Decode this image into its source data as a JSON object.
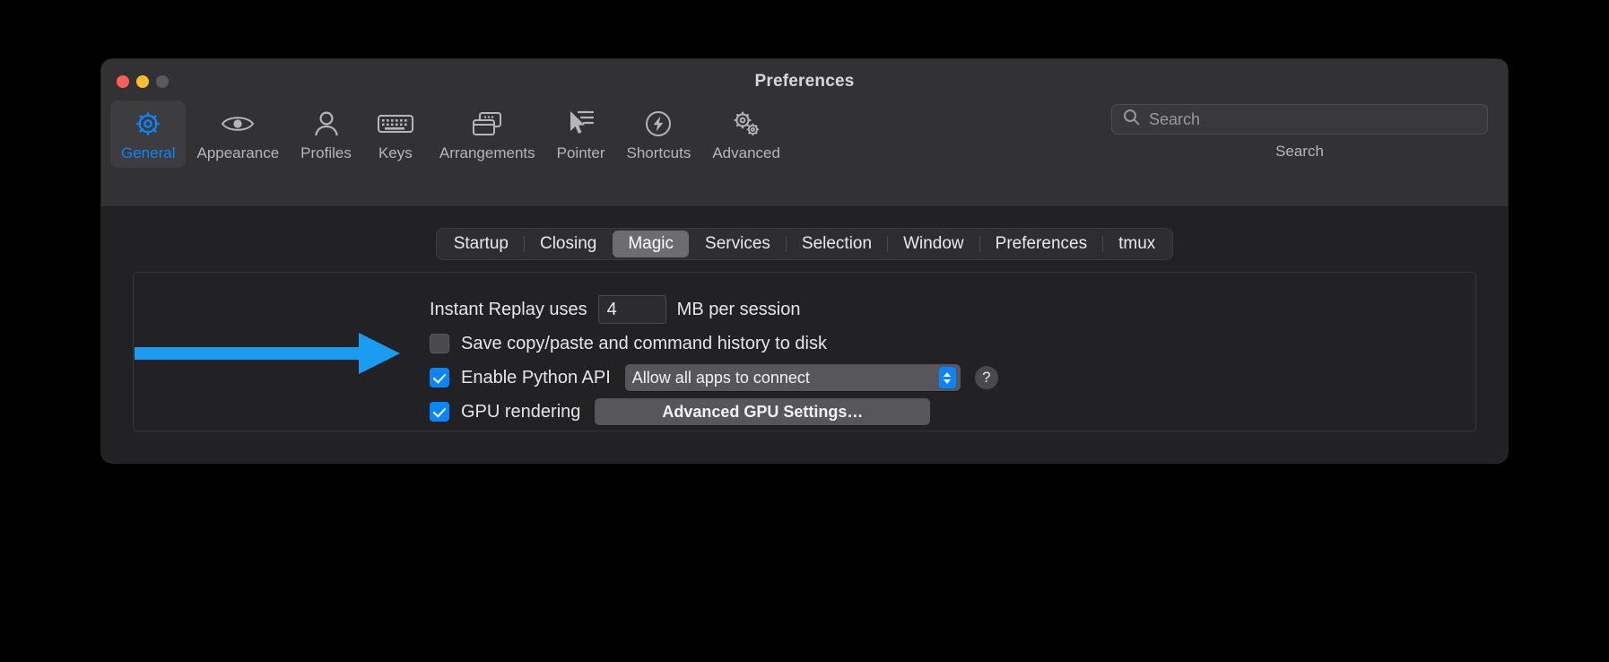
{
  "window": {
    "title": "Preferences",
    "traffic_lights": [
      "close-red",
      "minimize-yellow",
      "zoom-disabled"
    ]
  },
  "toolbar": {
    "items": [
      {
        "label": "General",
        "icon": "gear-icon",
        "selected": true
      },
      {
        "label": "Appearance",
        "icon": "eye-icon",
        "selected": false
      },
      {
        "label": "Profiles",
        "icon": "person-icon",
        "selected": false
      },
      {
        "label": "Keys",
        "icon": "keyboard-icon",
        "selected": false
      },
      {
        "label": "Arrangements",
        "icon": "windows-icon",
        "selected": false
      },
      {
        "label": "Pointer",
        "icon": "cursor-icon",
        "selected": false
      },
      {
        "label": "Shortcuts",
        "icon": "bolt-circle-icon",
        "selected": false
      },
      {
        "label": "Advanced",
        "icon": "two-gears-icon",
        "selected": false
      }
    ],
    "accent_color": "#0a84ff"
  },
  "search": {
    "placeholder": "Search",
    "value": "",
    "caption": "Search",
    "icon": "search-icon"
  },
  "tabs": {
    "items": [
      {
        "label": "Startup",
        "active": false
      },
      {
        "label": "Closing",
        "active": false
      },
      {
        "label": "Magic",
        "active": true
      },
      {
        "label": "Services",
        "active": false
      },
      {
        "label": "Selection",
        "active": false
      },
      {
        "label": "Window",
        "active": false
      },
      {
        "label": "Preferences",
        "active": false
      },
      {
        "label": "tmux",
        "active": false
      }
    ]
  },
  "settings": {
    "instant_replay": {
      "prefix_label": "Instant Replay uses",
      "value": "4",
      "suffix_label": "MB per session"
    },
    "save_history": {
      "label": "Save copy/paste and command history to disk",
      "checked": false
    },
    "python_api": {
      "label": "Enable Python API",
      "checked": true,
      "popup_value": "Allow all apps to connect",
      "popup_options": [
        "Allow all apps to connect"
      ],
      "help_label": "?"
    },
    "gpu_rendering": {
      "label": "GPU rendering",
      "checked": true,
      "button_label": "Advanced GPU Settings…"
    }
  },
  "annotation": {
    "arrow_color": "#1a9cf0",
    "arrow_points_to": "Enable Python API"
  }
}
